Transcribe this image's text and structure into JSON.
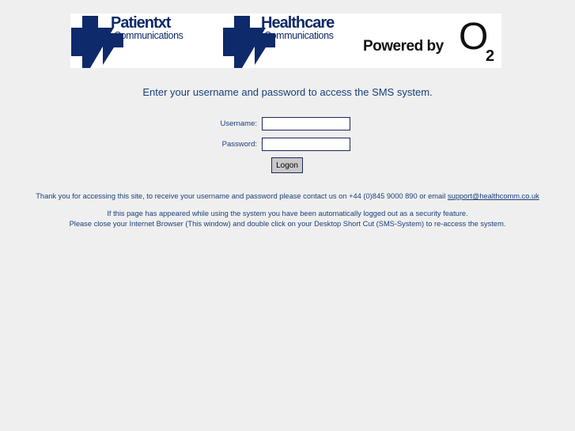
{
  "banner": {
    "brand1": {
      "name": "Patientxt",
      "sub": "Communications",
      "icon": "cross-logo-icon"
    },
    "brand2": {
      "name": "Healthcare",
      "sub": "Communications",
      "icon": "cross-logo-icon"
    },
    "powered_by": "Powered by",
    "o2_letter": "O",
    "o2_subscript": "2",
    "brand_color": "#0e2a6a"
  },
  "prompt": "Enter your username and password to access the SMS system.",
  "form": {
    "username_label": "Username:",
    "username_value": "",
    "password_label": "Password:",
    "password_value": "",
    "logon_label": "Logon"
  },
  "info": {
    "line1_text": "Thank you for accessing this site, to receive your username and password please contact us on +44 (0)845 9000 890 or email ",
    "line1_email": "support@healthcomm.co.uk",
    "line2": "If this page has appeared while using the system you have been automatically logged out as a security feature.",
    "line3": "Please close your Internet Browser (This window) and double click on your Desktop Short Cut (SMS-System) to re-access the system."
  },
  "colors": {
    "background": "#efefef",
    "text": "#1a3f7a"
  }
}
